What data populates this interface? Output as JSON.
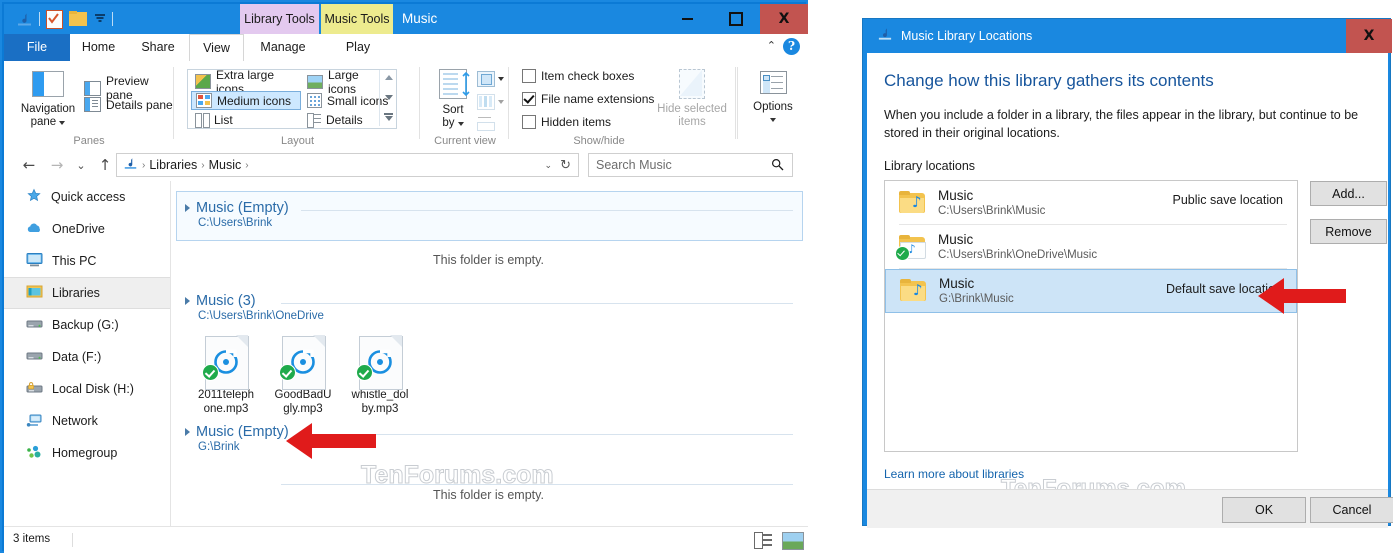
{
  "explorer": {
    "window_title": "Music",
    "quick_access_toolbar": [
      {
        "name": "music-library-icon",
        "label": "Music library"
      },
      {
        "name": "properties-icon",
        "label": "Properties"
      },
      {
        "name": "new-folder-icon",
        "label": "New folder"
      },
      {
        "name": "customize-qat-icon",
        "label": "Customize Quick Access Toolbar"
      }
    ],
    "contextual_tabs": [
      {
        "label": "Library Tools",
        "color": "#e3c9ef"
      },
      {
        "label": "Music Tools",
        "color": "#edeb8e"
      }
    ],
    "window_buttons": {
      "minimize": "–",
      "maximize": "□",
      "close": "X"
    },
    "ribbon_tabs": [
      {
        "label": "File",
        "active": false
      },
      {
        "label": "Home",
        "active": false
      },
      {
        "label": "Share",
        "active": false
      },
      {
        "label": "View",
        "active": true
      },
      {
        "label": "Manage",
        "active": false
      },
      {
        "label": "Play",
        "active": false
      }
    ],
    "help_glyph": "?",
    "collapse_glyph": "⌃",
    "ribbon": {
      "panes": {
        "group_label": "Panes",
        "navigation_pane": "Navigation\npane",
        "navigation_pane_line1": "Navigation",
        "navigation_pane_line2": "pane",
        "preview_pane": "Preview pane",
        "details_pane": "Details pane"
      },
      "layout": {
        "group_label": "Layout",
        "items": [
          {
            "label": "Extra large icons",
            "selected": false
          },
          {
            "label": "Large icons",
            "selected": false
          },
          {
            "label": "Medium icons",
            "selected": true
          },
          {
            "label": "Small icons",
            "selected": false
          },
          {
            "label": "List",
            "selected": false
          },
          {
            "label": "Details",
            "selected": false
          }
        ]
      },
      "current_view": {
        "group_label": "Current view",
        "sort_by_line1": "Sort",
        "sort_by_line2": "by"
      },
      "show_hide": {
        "group_label": "Show/hide",
        "checkboxes": [
          {
            "label": "Item check boxes",
            "checked": false
          },
          {
            "label": "File name extensions",
            "checked": true
          },
          {
            "label": "Hidden items",
            "checked": false
          }
        ],
        "hide_selected_line1": "Hide selected",
        "hide_selected_line2": "items",
        "hide_selected_disabled": true
      },
      "options": {
        "label": "Options"
      }
    },
    "address_bar": {
      "back": "←",
      "forward": "→",
      "recent": "⌄",
      "up": "↑",
      "breadcrumbs": [
        "Libraries",
        "Music"
      ],
      "separator": "›",
      "dropdown": "⌄",
      "refresh": "↻"
    },
    "search": {
      "placeholder": "Search Music",
      "icon": "🔍"
    },
    "nav_pane": [
      {
        "label": "Quick access",
        "icon": "star-icon",
        "selected": false
      },
      {
        "label": "OneDrive",
        "icon": "cloud-icon",
        "selected": false
      },
      {
        "label": "This PC",
        "icon": "monitor-icon",
        "selected": false
      },
      {
        "label": "Libraries",
        "icon": "libraries-icon",
        "selected": true
      },
      {
        "label": "Backup (G:)",
        "icon": "drive-icon",
        "selected": false
      },
      {
        "label": "Data (F:)",
        "icon": "drive-icon",
        "selected": false
      },
      {
        "label": "Local Disk (H:)",
        "icon": "locked-drive-icon",
        "selected": false
      },
      {
        "label": "Network",
        "icon": "network-icon",
        "selected": false
      },
      {
        "label": "Homegroup",
        "icon": "homegroup-icon",
        "selected": false
      }
    ],
    "groups": [
      {
        "title": "Music (Empty)",
        "path": "C:\\Users\\Brink",
        "empty_text": "This folder is empty.",
        "files": []
      },
      {
        "title": "Music (3)",
        "path": "C:\\Users\\Brink\\OneDrive",
        "empty_text": "",
        "files": [
          "2011telephone.mp3",
          "GoodBadUgly.mp3",
          "whistle_dolby.mp3"
        ]
      },
      {
        "title": "Music (Empty)",
        "path": "G:\\Brink",
        "empty_text": "This folder is empty.",
        "files": []
      }
    ],
    "file_name_lines": [
      [
        "2011teleph",
        "one.mp3"
      ],
      [
        "GoodBadU",
        "gly.mp3"
      ],
      [
        "whistle_dol",
        "by.mp3"
      ]
    ],
    "status_bar": {
      "item_count": "3 items",
      "view_details": "Details view",
      "view_large": "Large icons view"
    },
    "watermark": "TenForums.com"
  },
  "dialog": {
    "title": "Music Library Locations",
    "title_icon": "music-library-icon",
    "close": "X",
    "heading": "Change how this library gathers its contents",
    "description": "When you include a folder in a library, the files appear in the library, but continue to be stored in their original locations.",
    "section_label": "Library locations",
    "locations": [
      {
        "name": "Music",
        "path": "C:\\Users\\Brink\\Music",
        "badge": "Public save location",
        "selected": false,
        "synced": false
      },
      {
        "name": "Music",
        "path": "C:\\Users\\Brink\\OneDrive\\Music",
        "badge": "",
        "selected": false,
        "synced": true
      },
      {
        "name": "Music",
        "path": "G:\\Brink\\Music",
        "badge": "Default save location",
        "selected": true,
        "synced": false
      }
    ],
    "add_button": "Add...",
    "remove_button": "Remove",
    "learn_more": "Learn more about libraries",
    "ok_button": "OK",
    "cancel_button": "Cancel",
    "watermark": "TenForums.com"
  },
  "colors": {
    "accent": "#1a88e0",
    "close_red": "#c25450",
    "arrow_red": "#e01b1b",
    "link": "#1464ad"
  }
}
